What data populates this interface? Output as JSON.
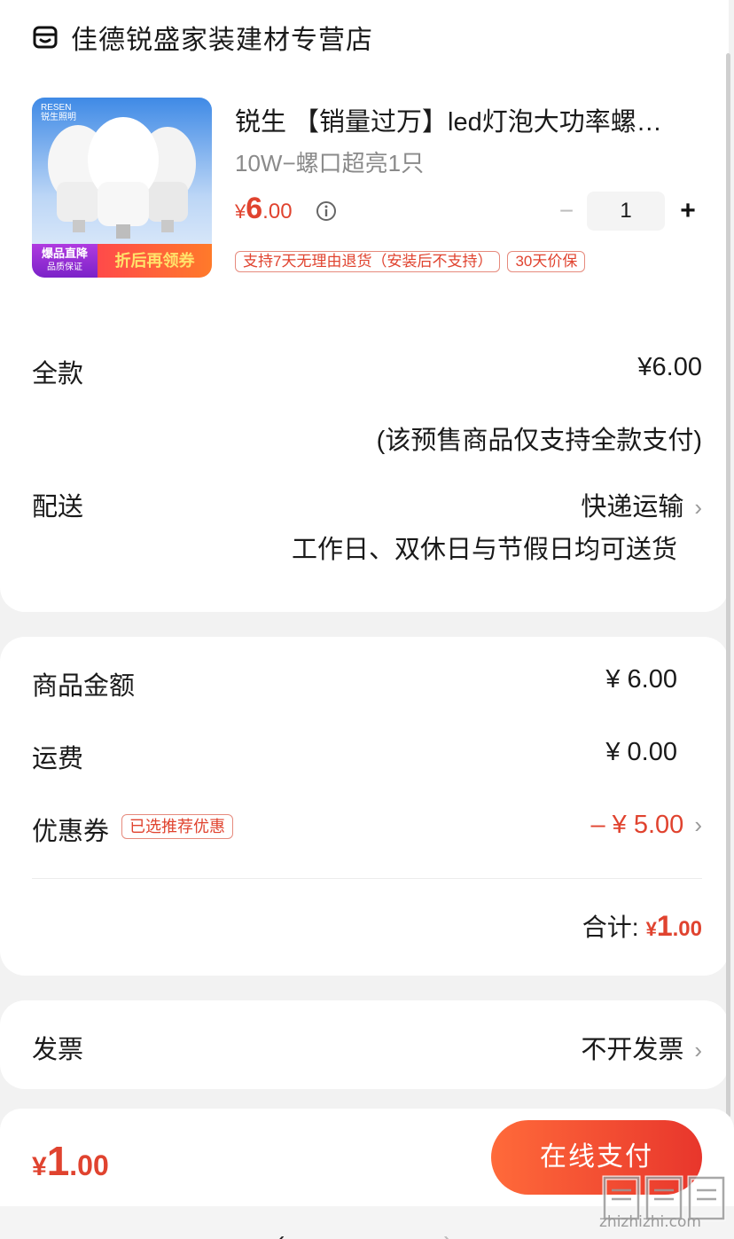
{
  "store": {
    "name": "佳德锐盛家装建材专营店",
    "icon": "store-icon"
  },
  "product": {
    "image_texts": {
      "brand_en": "RESEN",
      "brand_cn": "锐生照明",
      "badge_main": "爆品直降",
      "badge_sub": "品质保证",
      "coupon": "折后再领券"
    },
    "title": "锐生 【销量过万】led灯泡大功率螺…",
    "spec": "10W−螺口超亮1只",
    "price_symbol": "¥",
    "price_int": "6",
    "price_dec": ".00",
    "quantity": "1",
    "minus": "−",
    "plus": "+",
    "tags": [
      "支持7天无理由退货（安装后不支持）",
      "30天价保"
    ]
  },
  "payment": {
    "label": "全款",
    "value": "¥6.00",
    "note": "(该预售商品仅支持全款支付)"
  },
  "delivery": {
    "label": "配送",
    "value": "快递运输",
    "note": "工作日、双休日与节假日均可送货"
  },
  "summary": {
    "goods_label": "商品金额",
    "goods_value": "¥ 6.00",
    "shipping_label": "运费",
    "shipping_value": "¥ 0.00",
    "coupon_label": "优惠券",
    "coupon_tag": "已选推荐优惠",
    "coupon_value": "– ¥ 5.00",
    "total_label": "合计:",
    "total_symbol": "¥",
    "total_int": "1",
    "total_dec": ".00"
  },
  "invoice": {
    "label": "发票",
    "value": "不开发票"
  },
  "bottom": {
    "price_symbol": "¥",
    "price_int": "1",
    "price_dec": ".00",
    "pay_label": "在线支付"
  },
  "nav": {
    "back": "‹",
    "forward": "›"
  },
  "watermark": "zhizhizhi.com",
  "colors": {
    "accent": "#e0432f",
    "button_start": "#ff6a3a",
    "button_end": "#e8362c"
  }
}
